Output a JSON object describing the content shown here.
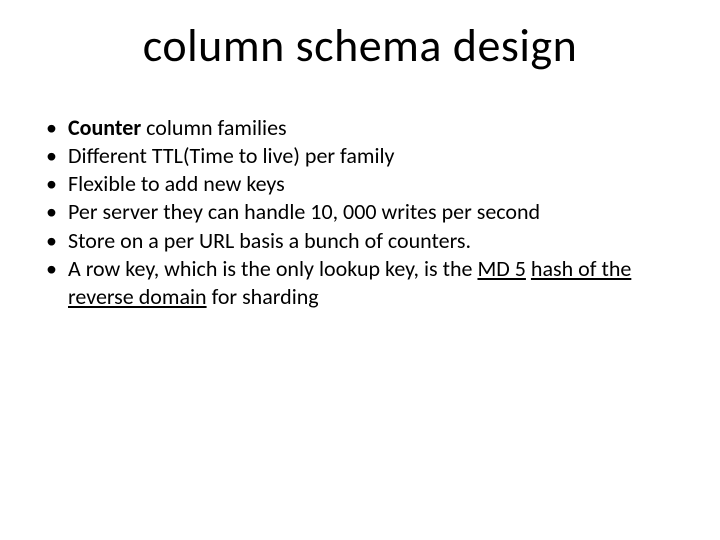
{
  "title": "column schema design",
  "bullets": [
    {
      "bold": "Counter",
      "rest": " column families"
    },
    {
      "text": "Different TTL(Time to live) per family"
    },
    {
      "text": "Flexible to add new keys"
    },
    {
      "text": "Per server they can handle 10, 000 writes per second"
    },
    {
      "text": "Store on a per URL basis a bunch of counters."
    },
    {
      "pre": "A row key, which is the only lookup key, is the ",
      "u1": "MD 5",
      "mid": " ",
      "u2": "hash of the reverse domain",
      "post": " for sharding"
    }
  ]
}
